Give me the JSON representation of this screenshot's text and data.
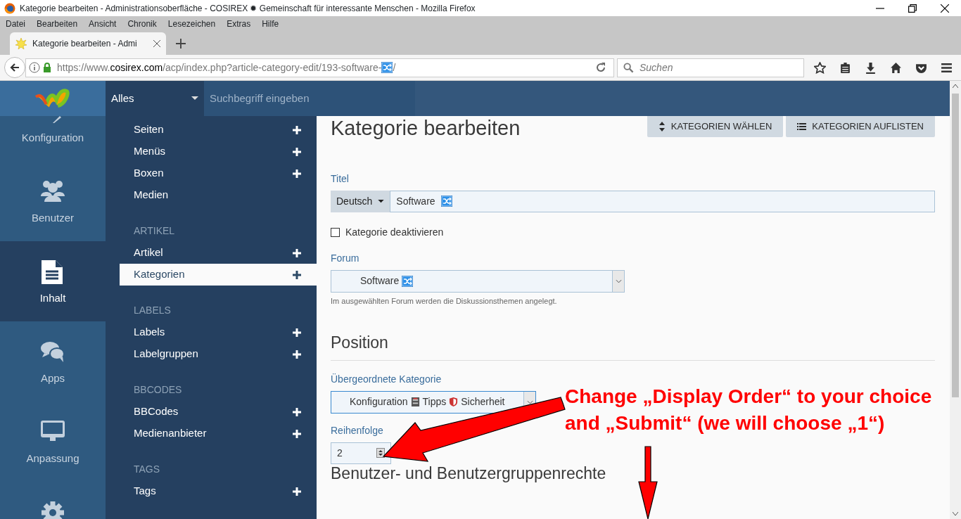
{
  "window": {
    "title": "Kategorie bearbeiten - Administrationsoberfläche - COSIREX ✹ Gemeinschaft für interessante Menschen - Mozilla Firefox"
  },
  "menu_bar": [
    "Datei",
    "Bearbeiten",
    "Ansicht",
    "Chronik",
    "Lesezeichen",
    "Extras",
    "Hilfe"
  ],
  "tabs": [
    {
      "label": "Kategorie bearbeiten - Admi",
      "selected": true
    }
  ],
  "address_bar": {
    "scheme": "https://www.",
    "host": "cosirex.com",
    "path": "/acp/index.php?article-category-edit/193-software-",
    "tail": "/"
  },
  "search": {
    "placeholder": "Suchen"
  },
  "header": {
    "scope": "Alles",
    "search_placeholder": "Suchbegriff eingeben"
  },
  "sidebar": {
    "items": [
      {
        "label": "Konfiguration",
        "selected": false
      },
      {
        "label": "Benutzer",
        "selected": false
      },
      {
        "label": "Inhalt",
        "selected": true
      },
      {
        "label": "Apps",
        "selected": false
      },
      {
        "label": "Anpassung",
        "selected": false
      }
    ]
  },
  "submenu": {
    "sections": [
      {
        "items": [
          {
            "label": "Seiten",
            "selected": false,
            "add_button": true
          },
          {
            "label": "Menüs",
            "selected": false,
            "add_button": true
          },
          {
            "label": "Boxen",
            "selected": false,
            "add_button": true
          },
          {
            "label": "Medien",
            "selected": false,
            "add_button": false
          }
        ]
      },
      {
        "heading": "ARTIKEL",
        "items": [
          {
            "label": "Artikel",
            "selected": false,
            "add_button": true
          },
          {
            "label": "Kategorien",
            "selected": true,
            "add_button": true
          }
        ]
      },
      {
        "heading": "LABELS",
        "items": [
          {
            "label": "Labels",
            "selected": false,
            "add_button": true
          },
          {
            "label": "Labelgruppen",
            "selected": false,
            "add_button": true
          }
        ]
      },
      {
        "heading": "BBCODES",
        "items": [
          {
            "label": "BBCodes",
            "selected": false,
            "add_button": true
          },
          {
            "label": "Medienanbieter",
            "selected": false,
            "add_button": true
          }
        ]
      },
      {
        "heading": "TAGS",
        "items": [
          {
            "label": "Tags",
            "selected": false,
            "add_button": true
          }
        ]
      }
    ]
  },
  "content": {
    "title": "Kategorie bearbeiten",
    "buttons": [
      "KATEGORIEN WÄHLEN",
      "KATEGORIEN AUFLISTEN"
    ],
    "title_field": {
      "label": "Titel",
      "language": "Deutsch",
      "value": "Software"
    },
    "disable_checkbox": {
      "label": "Kategorie deaktivieren",
      "checked": false
    },
    "forum": {
      "label": "Forum",
      "value": "Software",
      "help": "Im ausgewählten Forum werden die Diskussionsthemen angelegt."
    },
    "position_heading": "Position",
    "parent_category": {
      "label": "Übergeordnete Kategorie",
      "segments": [
        "Konfiguration",
        "Tipps",
        "Sicherheit"
      ]
    },
    "order": {
      "label": "Reihenfolge",
      "value": "2"
    },
    "permissions_heading": "Benutzer- und Benutzergruppenrechte"
  },
  "annotation": {
    "text": "Change „Display Order“ to your choice and „Submit“ (we will choose „1“)"
  }
}
